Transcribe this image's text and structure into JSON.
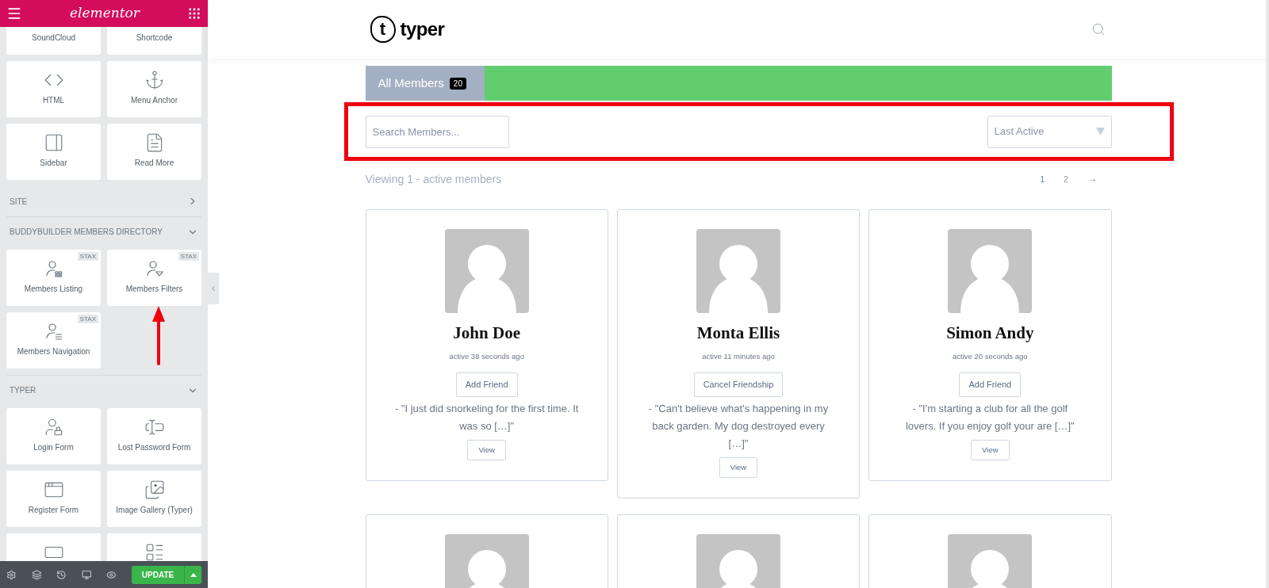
{
  "editor": {
    "brand": "elementor",
    "sections": [
      {
        "widgets": [
          {
            "label": "SoundCloud"
          },
          {
            "label": "Shortcode"
          },
          {
            "label": "HTML"
          },
          {
            "label": "Menu Anchor"
          },
          {
            "label": "Sidebar"
          },
          {
            "label": "Read More"
          }
        ]
      },
      {
        "title": "SITE",
        "expanded": false
      },
      {
        "title": "BUDDYBUILDER MEMBERS DIRECTORY",
        "expanded": true,
        "widgets": [
          {
            "label": "Members Listing",
            "badge": "STAX"
          },
          {
            "label": "Members Filters",
            "badge": "STAX"
          },
          {
            "label": "Members Navigation",
            "badge": "STAX"
          }
        ]
      },
      {
        "title": "TYPER",
        "expanded": true,
        "widgets": [
          {
            "label": "Login Form"
          },
          {
            "label": "Lost Password Form"
          },
          {
            "label": "Register Form"
          },
          {
            "label": "Image Gallery (Typer)"
          }
        ]
      }
    ],
    "update_button": "UPDATE"
  },
  "site": {
    "logo_letter": "t",
    "logo_text": "typer"
  },
  "tabs": [
    {
      "label": "All Members",
      "count": "20",
      "selected": true
    }
  ],
  "filters": {
    "search": {
      "placeholder": "Search Members..."
    },
    "sort": {
      "value": "Last Active"
    }
  },
  "viewing": "Viewing 1 - active members",
  "pagination": {
    "pages": [
      {
        "label": "1",
        "selected": true
      },
      {
        "label": "2",
        "selected": false
      }
    ],
    "next": "→"
  },
  "members": [
    {
      "name": "John Doe",
      "activity": "active 38 seconds ago",
      "action": "Add Friend",
      "excerpt": "- \"I just did snorkeling for the first time. It was so […]\"",
      "view": "View"
    },
    {
      "name": "Monta Ellis",
      "activity": "active 11 minutes ago",
      "action": "Cancel Friendship",
      "excerpt": "- \"Can't believe what's happening in my back garden. My dog destroyed every […]\"",
      "view": "View"
    },
    {
      "name": "Simon Andy",
      "activity": "active 20 seconds ago",
      "action": "Add Friend",
      "excerpt": "- \"I'm starting a club for all the golf lovers. If you enjoy golf your are […]\"",
      "view": "View"
    }
  ]
}
